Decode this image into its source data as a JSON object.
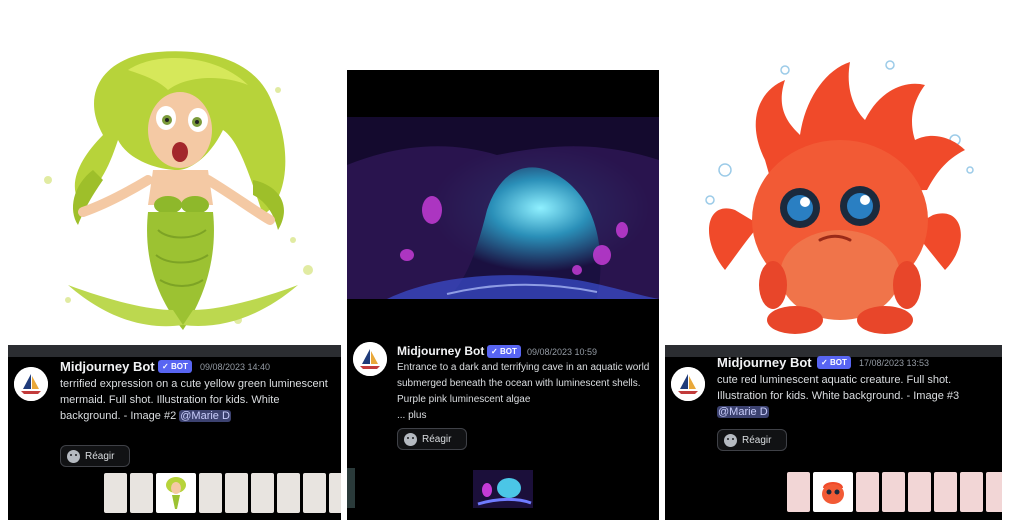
{
  "posts": [
    {
      "username": "Midjourney Bot",
      "badge": "BOT",
      "timestamp": "09/08/2023 14:40",
      "message": "terrified expression on a cute yellow green luminescent mermaid. Full shot. Illustration for kids. White background. - Image #2",
      "mention": "@Marie D",
      "react_label": "Réagir"
    },
    {
      "username": "Midjourney Bot",
      "badge": "BOT",
      "timestamp": "09/08/2023 10:59",
      "message": "Entrance to a dark and terrifying cave in an aquatic world submerged beneath the ocean with luminescent shells. Purple pink luminescent algae",
      "more": "... plus",
      "react_label": "Réagir"
    },
    {
      "username": "Midjourney Bot",
      "badge": "BOT",
      "timestamp": "17/08/2023 13:53",
      "message": "cute red luminescent aquatic creature. Full shot. Illustration for kids. White background. - Image #3",
      "mention": "@Marie D",
      "react_label": "Réagir"
    }
  ],
  "icons": {
    "avatar": "midjourney-sailboat-icon",
    "react": "smiley-face-icon"
  },
  "colors": {
    "chat_bg": "#000000",
    "badge": "#5865f2",
    "mention_bg": "#3c4270",
    "mention_fg": "#c9cdfb"
  }
}
